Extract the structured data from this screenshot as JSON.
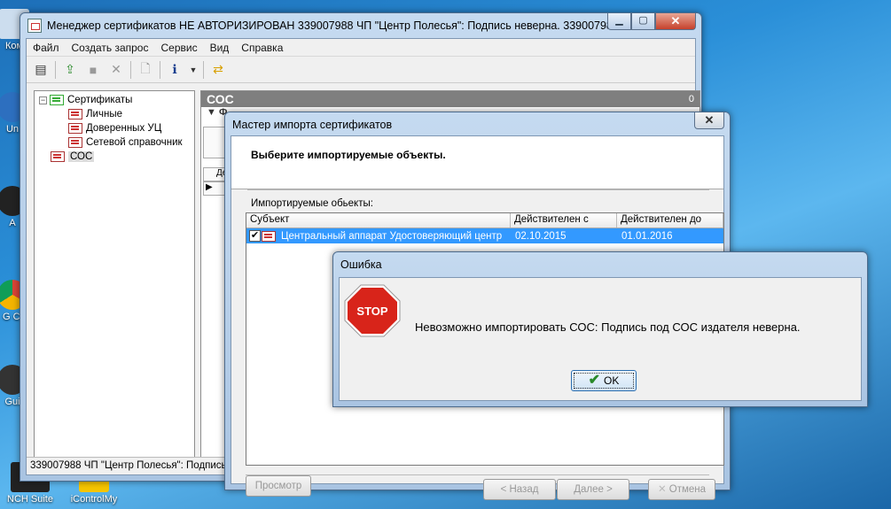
{
  "colors": {
    "selection": "#3399ff",
    "stop_red": "#d8241a",
    "ok_check": "#2a8a2a"
  },
  "desktop": {
    "icons": [
      {
        "label": "Ком"
      },
      {
        "label": "Un"
      },
      {
        "label": "А"
      },
      {
        "label": "G Cl"
      },
      {
        "label": "Gui"
      },
      {
        "label": "NCH Suite"
      },
      {
        "label": "iControlMy"
      }
    ]
  },
  "main_window": {
    "title": "Менеджер сертификатов  НЕ АВТОРИЗИРОВАН  339007988 ЧП \"Центр Полесья\": Подпись неверна.  33900798...",
    "menu": [
      "Файл",
      "Создать запрос",
      "Сервис",
      "Вид",
      "Справка"
    ],
    "tree": {
      "root": "Сертификаты",
      "children": [
        "Личные",
        "Доверенных УЦ",
        "Сетевой справочник"
      ],
      "selected": "СОС"
    },
    "pane": {
      "title": "СОС",
      "count": "0",
      "filter_label": "Ф",
      "grid_col": "Де"
    },
    "status": "339007988 ЧП \"Центр Полесья\": Подпись"
  },
  "wizard": {
    "title": "Мастер импорта сертификатов",
    "heading": "Выберите импортируемые объекты.",
    "list_label": "Импортируемые обьекты:",
    "columns": [
      "Субъект",
      "Действителен с",
      "Действителен до"
    ],
    "rows": [
      {
        "subject": "Центральный аппарат Удостоверяющий центр",
        "valid_from": "02.10.2015",
        "valid_to": "01.01.2016",
        "checked": true
      }
    ],
    "buttons": {
      "view": "Просмотр",
      "back": "< Назад",
      "next": "Далее >",
      "cancel": "Отмена"
    }
  },
  "error_dialog": {
    "title": "Ошибка",
    "icon_text": "STOP",
    "message": "Невозможно импортировать СОС: Подпись под СОС издателя неверна.",
    "ok_label": "OK"
  }
}
